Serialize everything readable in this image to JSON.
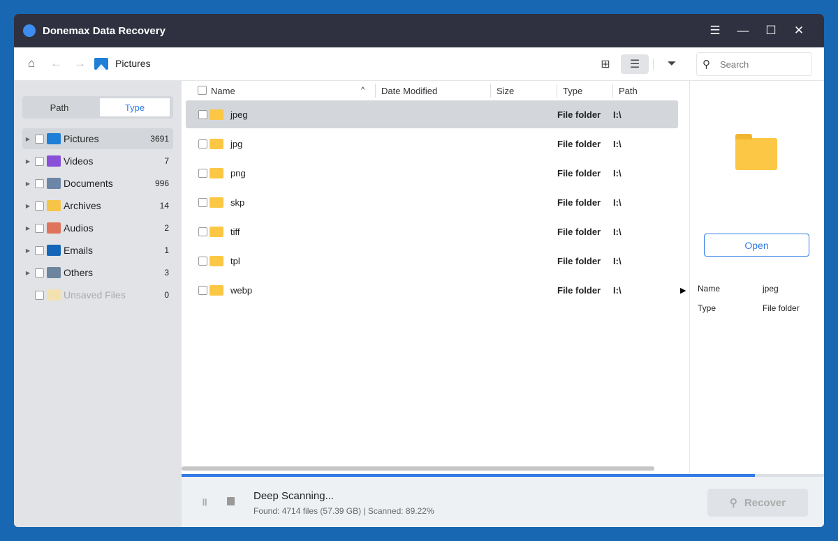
{
  "app": {
    "title": "Donemax Data Recovery"
  },
  "toolbar": {
    "breadcrumb": "Pictures",
    "search_placeholder": "Search"
  },
  "sidebar": {
    "tabs": [
      "Path",
      "Type"
    ],
    "active_tab": "Type",
    "items": [
      {
        "label": "Pictures",
        "count": "3691",
        "color": "#1f7fd6"
      },
      {
        "label": "Videos",
        "count": "7",
        "color": "#8a4fd8"
      },
      {
        "label": "Documents",
        "count": "996",
        "color": "#6b86a6"
      },
      {
        "label": "Archives",
        "count": "14",
        "color": "#f6c548"
      },
      {
        "label": "Audios",
        "count": "2",
        "color": "#e0745a"
      },
      {
        "label": "Emails",
        "count": "1",
        "color": "#1466b8"
      },
      {
        "label": "Others",
        "count": "3",
        "color": "#6e859e"
      },
      {
        "label": "Unsaved Files",
        "count": "0",
        "color": "#f3e2b0"
      }
    ]
  },
  "table": {
    "columns": [
      "Name",
      "Date Modified",
      "Size",
      "Type",
      "Path"
    ],
    "rows": [
      {
        "name": "jpeg",
        "type": "File folder",
        "path": "I:\\"
      },
      {
        "name": "jpg",
        "type": "File folder",
        "path": "I:\\"
      },
      {
        "name": "png",
        "type": "File folder",
        "path": "I:\\"
      },
      {
        "name": "skp",
        "type": "File folder",
        "path": "I:\\"
      },
      {
        "name": "tiff",
        "type": "File folder",
        "path": "I:\\"
      },
      {
        "name": "tpl",
        "type": "File folder",
        "path": "I:\\"
      },
      {
        "name": "webp",
        "type": "File folder",
        "path": "I:\\"
      }
    ]
  },
  "preview": {
    "open_label": "Open",
    "name_label": "Name",
    "name_value": "jpeg",
    "type_label": "Type",
    "type_value": "File folder"
  },
  "status": {
    "title": "Deep Scanning...",
    "detail": "Found: 4714 files (57.39 GB) | Scanned: 89.22%",
    "progress_percent": 89.22,
    "recover_label": "Recover"
  }
}
